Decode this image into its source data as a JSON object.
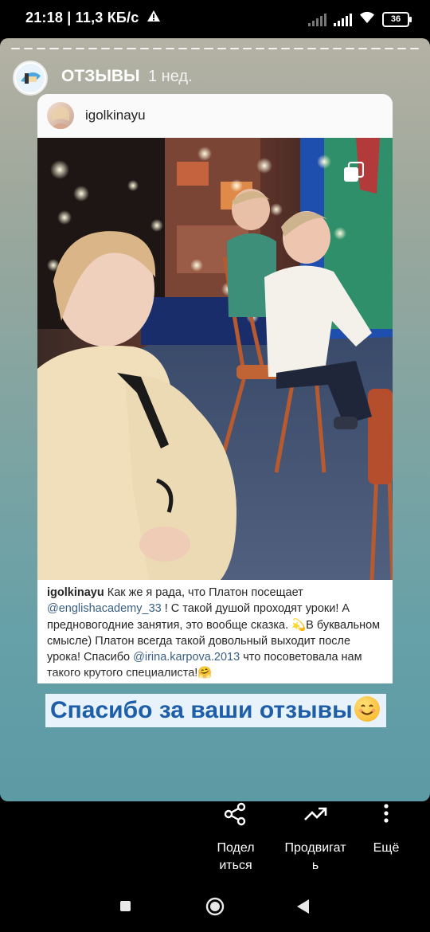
{
  "status_bar": {
    "time_speed": "21:18 | 11,3 КБ/с",
    "battery": "36"
  },
  "story": {
    "name": "ОТЗЫВЫ",
    "time": "1 нед."
  },
  "post": {
    "username": "igolkinayu",
    "caption_user": "igolkinayu",
    "caption_1": " Как же я рада, что Платон посещает ",
    "mention_1": "@englishacademy_33",
    "caption_2": " ! С такой душой проходят уроки! А предновогодние занятия, это вообще сказка. 💫В буквальном смысле) Платон всегда такой довольный выходит после урока! Спасибо ",
    "mention_2": "@irina.karpova.2013",
    "caption_3": " что посоветовала нам такого крутого специалиста!🤗"
  },
  "banner": {
    "text": "Спасибо за ваши отзывы"
  },
  "actions": {
    "share": "Подел\nиться",
    "promote": "Продвигат\nь",
    "more": "Ещё"
  },
  "icons": {
    "status": [
      "warning-icon",
      "signal-icon",
      "wifi-icon",
      "battery-icon"
    ],
    "actions": [
      "share-icon",
      "trending-up-icon",
      "more-vertical-icon"
    ],
    "nav": [
      "recents-square-icon",
      "home-circle-icon",
      "back-triangle-icon"
    ]
  }
}
